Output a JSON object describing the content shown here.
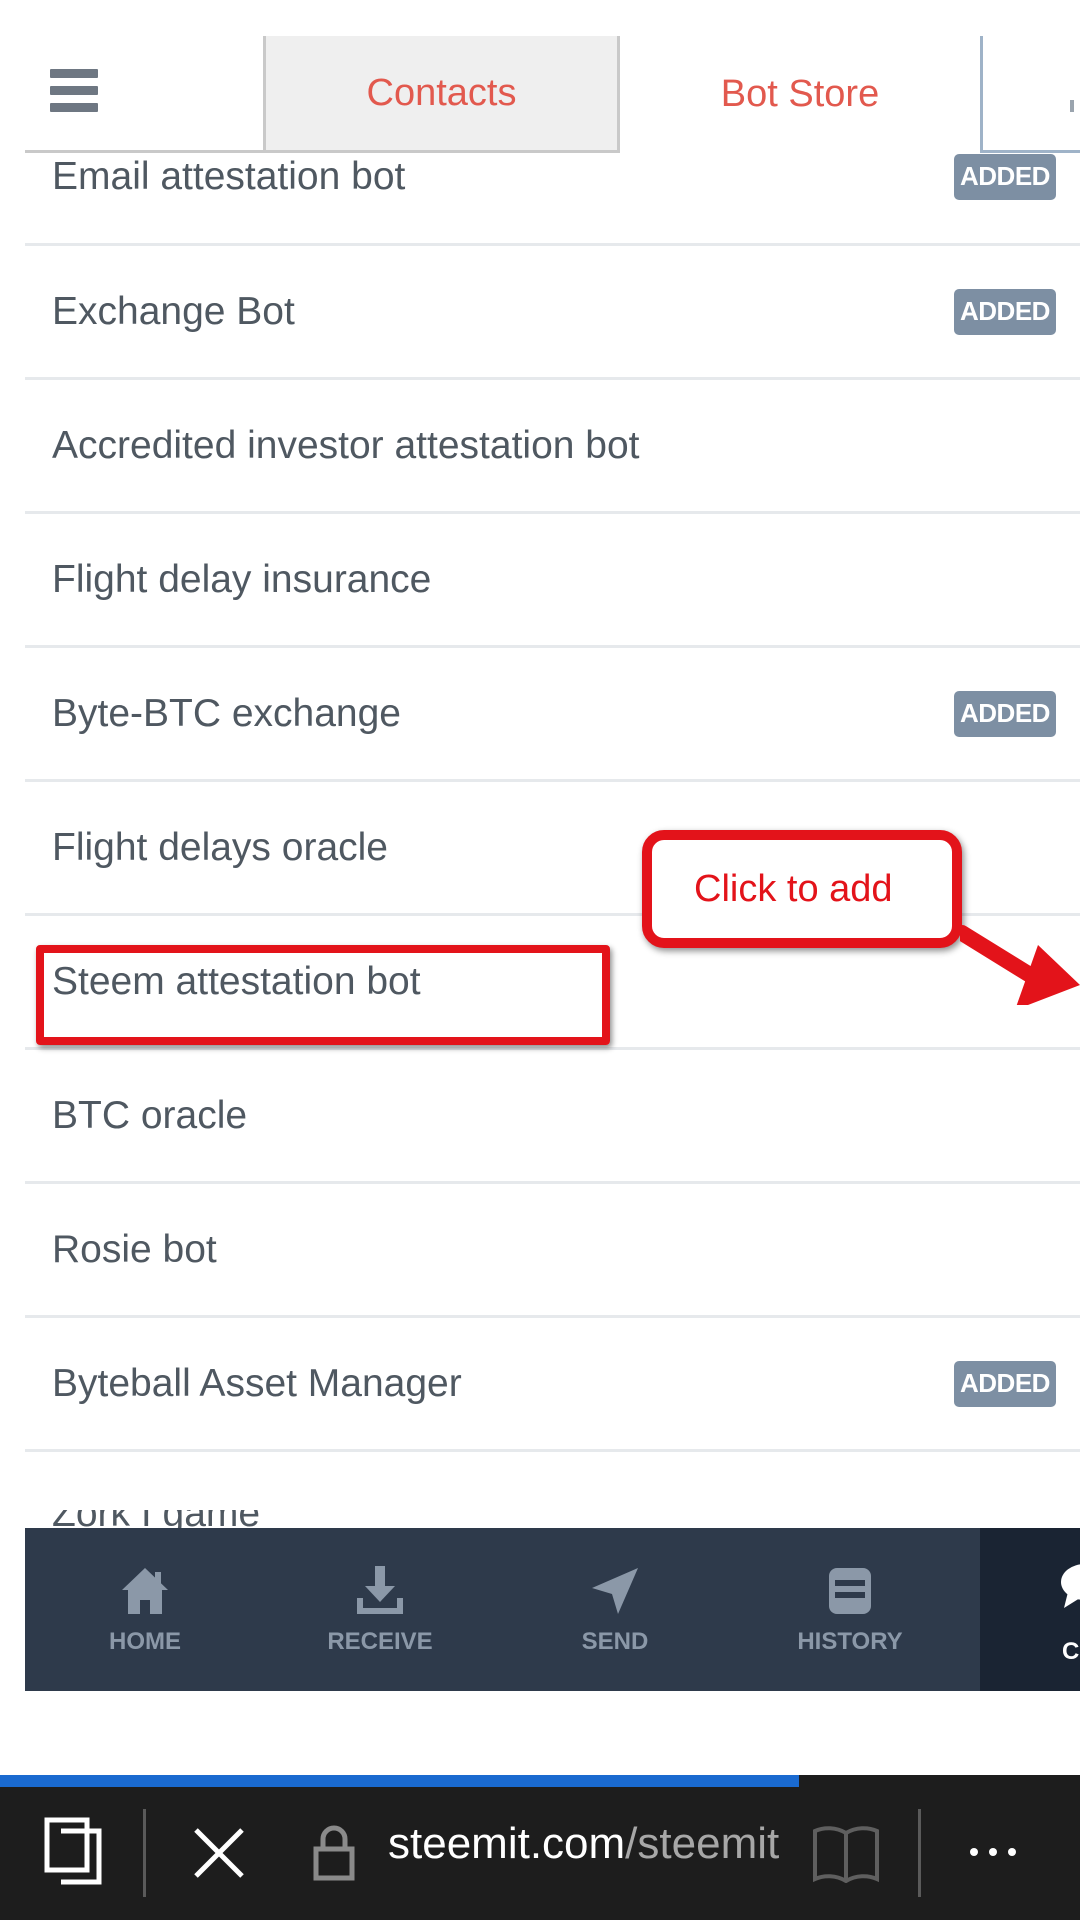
{
  "tabs": {
    "contacts": "Contacts",
    "bot_store": "Bot Store"
  },
  "bots": [
    {
      "name": "Email attestation bot",
      "badge": "ADDED"
    },
    {
      "name": "Exchange Bot",
      "badge": "ADDED"
    },
    {
      "name": "Accredited investor attestation bot",
      "badge": ""
    },
    {
      "name": "Flight delay insurance",
      "badge": ""
    },
    {
      "name": "Byte-BTC exchange",
      "badge": "ADDED"
    },
    {
      "name": "Flight delays oracle",
      "badge": ""
    },
    {
      "name": "Steem attestation bot",
      "badge": ""
    },
    {
      "name": "BTC oracle",
      "badge": ""
    },
    {
      "name": "Rosie bot",
      "badge": ""
    },
    {
      "name": "Byteball Asset Manager",
      "badge": "ADDED"
    }
  ],
  "partial_bot": "Zork I game",
  "annotation": {
    "callout": "Click to add"
  },
  "nav": {
    "home": "HOME",
    "receive": "RECEIVE",
    "send": "SEND",
    "history": "HISTORY",
    "active_partial": "C"
  },
  "browser": {
    "domain": "steemit.com",
    "path": "/steemit",
    "progress": 0.74
  },
  "colors": {
    "tab_text": "#e2594e",
    "badge_bg": "#7d8fa3",
    "nav_bg": "#2e3a4b",
    "annotation_red": "#e3131a",
    "progress": "#1a6ad0"
  },
  "icons": [
    "menu-icon",
    "home-icon",
    "receive-icon",
    "send-icon",
    "history-icon",
    "chat-icon",
    "tabs-icon",
    "close-icon",
    "lock-icon",
    "reading-view-icon",
    "more-icon"
  ]
}
